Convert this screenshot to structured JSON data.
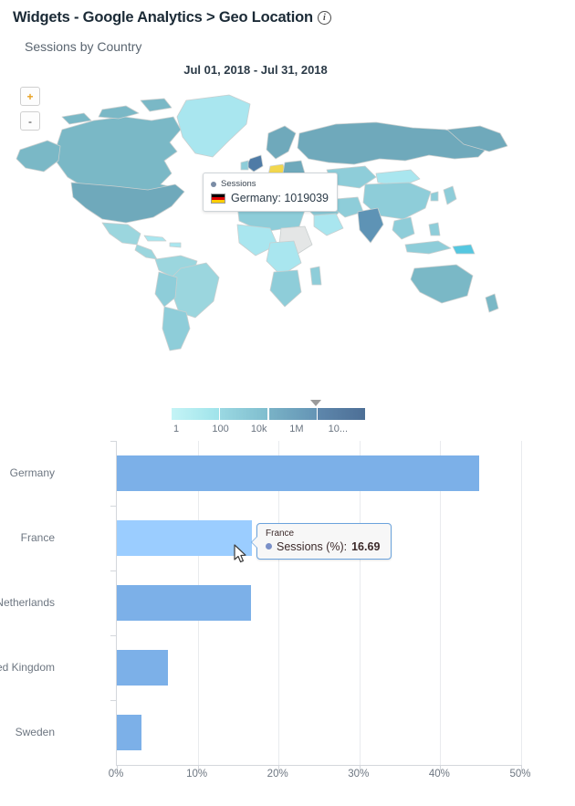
{
  "header": {
    "title": "Widgets - Google Analytics > Geo Location",
    "info_icon": "info-icon",
    "info_glyph": "i"
  },
  "map_panel": {
    "subtitle": "Sessions by Country",
    "date_range": "Jul 01, 2018 - Jul 31, 2018",
    "zoom_in_label": "+",
    "zoom_out_label": "-",
    "tooltip": {
      "series_label": "Sessions",
      "country": "Germany",
      "value": "1019039",
      "value_line": "Germany: 1019039",
      "flag": "de-flag-icon"
    },
    "legend": {
      "labels": [
        "1",
        "100",
        "10k",
        "1M",
        "10..."
      ],
      "colors": [
        "#a8eef1",
        "#8ecfdb",
        "#6fa7bf",
        "#4f7ba6"
      ],
      "marker_position_pct": 72
    },
    "map_colors": {
      "low": "#b8eaf0",
      "mid": "#8ecdd9",
      "high": "#5e93b5",
      "highlight": "#f2d74e",
      "no_data": "#e4e6e6",
      "stroke": "#c9cfcf"
    }
  },
  "chart_data": {
    "type": "bar",
    "orientation": "horizontal",
    "title": "Sessions by Country",
    "categories": [
      "Germany",
      "France",
      "Netherlands",
      "United Kingdom",
      "Sweden"
    ],
    "series": [
      {
        "name": "Sessions (%)",
        "values": [
          44.8,
          16.69,
          16.6,
          6.3,
          3.0
        ]
      }
    ],
    "xlabel": "",
    "ylabel": "",
    "xlim": [
      0,
      50
    ],
    "xticks": [
      0,
      10,
      20,
      30,
      40,
      50
    ],
    "xtick_labels": [
      "0%",
      "10%",
      "20%",
      "30%",
      "40%",
      "50%"
    ],
    "grid": true,
    "legend": "none",
    "bar_color": "#7cb0e8",
    "highlight_color": "#9bcdff",
    "highlighted_category": "France"
  },
  "bar_tooltip": {
    "title": "France",
    "series_label": "Sessions (%):",
    "value": "16.69"
  },
  "cursor": "mouse-pointer"
}
